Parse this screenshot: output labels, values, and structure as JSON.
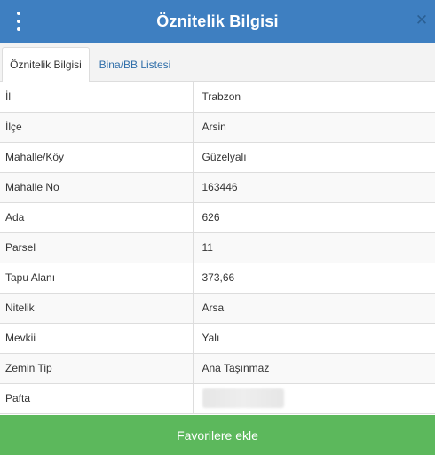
{
  "header": {
    "title": "Öznitelik Bilgisi",
    "menu_icon": "kebab-vertical-icon",
    "close_icon": "close-icon",
    "close_glyph": "✕",
    "background_color": "#3e7fc1"
  },
  "tabs": [
    {
      "label": "Öznitelik Bilgisi",
      "active": true
    },
    {
      "label": "Bina/BB Listesi",
      "active": false
    }
  ],
  "rows": [
    {
      "label": "İl",
      "value": "Trabzon"
    },
    {
      "label": "İlçe",
      "value": "Arsin"
    },
    {
      "label": "Mahalle/Köy",
      "value": "Güzelyalı"
    },
    {
      "label": "Mahalle No",
      "value": "163446"
    },
    {
      "label": "Ada",
      "value": "626"
    },
    {
      "label": "Parsel",
      "value": "11"
    },
    {
      "label": "Tapu Alanı",
      "value": "373,66"
    },
    {
      "label": "Nitelik",
      "value": "Arsa"
    },
    {
      "label": "Mevkii",
      "value": "Yalı"
    },
    {
      "label": "Zemin Tip",
      "value": "Ana Taşınmaz"
    },
    {
      "label": "Pafta",
      "value": null
    }
  ],
  "footer": {
    "button_label": "Favorilere ekle",
    "button_color": "#5cb85c"
  }
}
